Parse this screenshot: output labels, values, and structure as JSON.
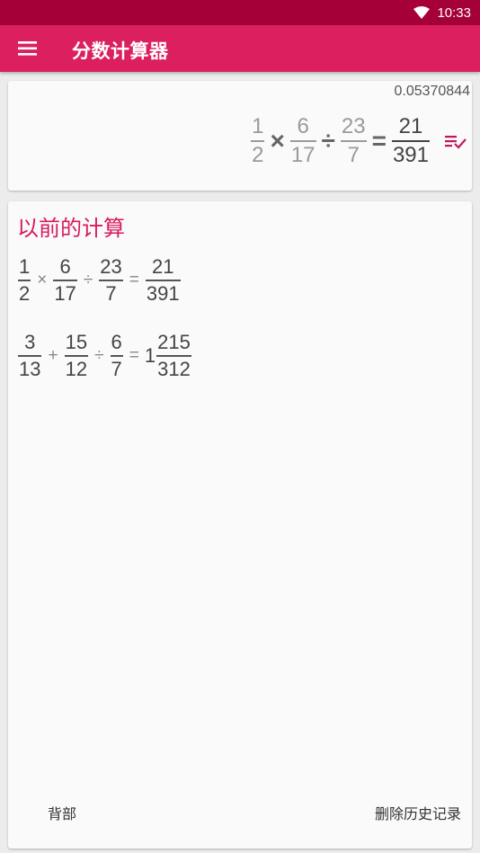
{
  "status": {
    "time": "10:33"
  },
  "toolbar": {
    "title": "分数计算器"
  },
  "display": {
    "decimal": "0.05370844",
    "expression": {
      "f1": {
        "num": "1",
        "den": "2"
      },
      "op1": "×",
      "f2": {
        "num": "6",
        "den": "17"
      },
      "op2": "÷",
      "f3": {
        "num": "23",
        "den": "7"
      },
      "eq": "=",
      "result": {
        "num": "21",
        "den": "391"
      }
    }
  },
  "history": {
    "title": "以前的计算",
    "rows": [
      {
        "f1": {
          "num": "1",
          "den": "2"
        },
        "op1": "×",
        "f2": {
          "num": "6",
          "den": "17"
        },
        "op2": "÷",
        "f3": {
          "num": "23",
          "den": "7"
        },
        "eq": "=",
        "result": {
          "num": "21",
          "den": "391"
        }
      },
      {
        "f1": {
          "num": "3",
          "den": "13"
        },
        "op1": "+",
        "f2": {
          "num": "15",
          "den": "12"
        },
        "op2": "÷",
        "f3": {
          "num": "6",
          "den": "7"
        },
        "eq": "=",
        "result": {
          "whole": "1",
          "num": "215",
          "den": "312"
        }
      }
    ]
  },
  "footer": {
    "back_label": "背部",
    "delete_label": "删除历史记录"
  },
  "colors": {
    "status_bar": "#a50038",
    "toolbar": "#dc1f5e",
    "accent": "#d81b60"
  },
  "icons": {
    "menu": "hamburger-icon",
    "wifi": "wifi-icon",
    "clear": "clear-list-icon"
  }
}
